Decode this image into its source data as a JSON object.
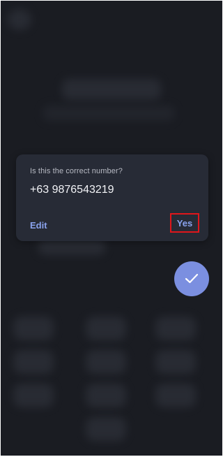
{
  "dialog": {
    "prompt": "Is this the correct number?",
    "phone_number": "+63 9876543219",
    "edit_label": "Edit",
    "yes_label": "Yes"
  },
  "fab": {
    "icon": "checkmark-icon"
  },
  "colors": {
    "background": "#1a1c22",
    "dialog": "#272b36",
    "accent": "#8aa3ee",
    "fab": "#7b8fe0",
    "highlight": "#e0161b"
  }
}
